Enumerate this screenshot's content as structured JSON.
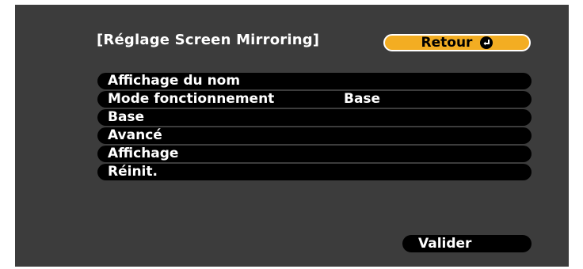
{
  "header": {
    "title": "[Réglage Screen Mirroring]",
    "back_label": "Retour"
  },
  "menu": {
    "items": [
      {
        "label": "Affichage du nom",
        "value": ""
      },
      {
        "label": "Mode fonctionnement",
        "value": "Base"
      },
      {
        "label": "Base",
        "value": ""
      },
      {
        "label": "Avancé",
        "value": ""
      },
      {
        "label": "Affichage",
        "value": ""
      },
      {
        "label": "Réinit.",
        "value": ""
      }
    ]
  },
  "footer": {
    "confirm_label": "Valider"
  },
  "colors": {
    "background": "#3c3c3c",
    "accent": "#f3ad22",
    "row": "#000000",
    "text": "#ffffff"
  },
  "icons": {
    "back": "enter-return-icon"
  }
}
